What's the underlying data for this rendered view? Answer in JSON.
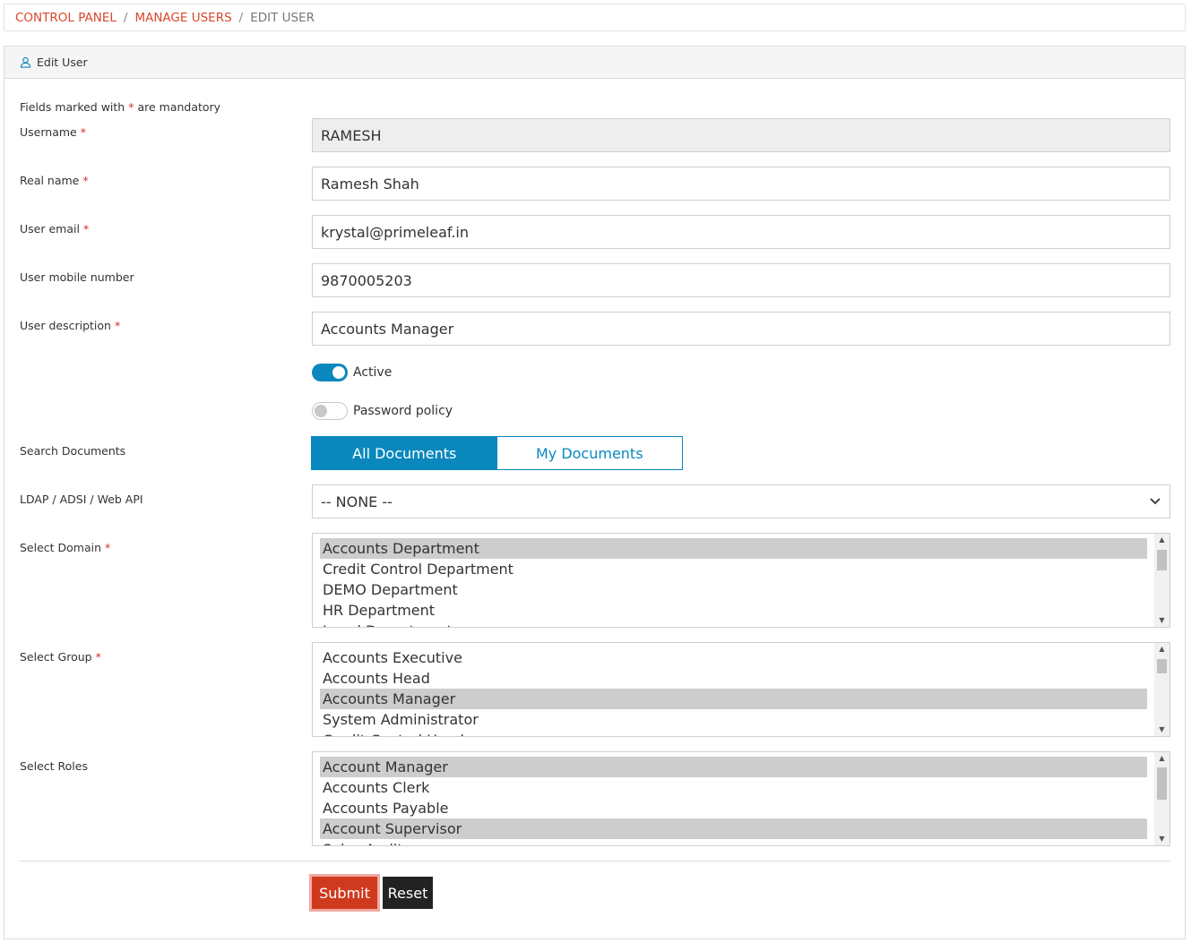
{
  "breadcrumb": {
    "items": [
      {
        "label": "CONTROL PANEL"
      },
      {
        "label": "MANAGE USERS"
      },
      {
        "label": "EDIT USER"
      }
    ],
    "separator": "/"
  },
  "panel": {
    "title": "Edit User",
    "mandatory_prefix": "Fields marked with",
    "mandatory_star": "*",
    "mandatory_suffix": "are mandatory"
  },
  "form": {
    "username": {
      "label": "Username",
      "value": "RAMESH"
    },
    "real_name": {
      "label": "Real name",
      "value": "Ramesh Shah"
    },
    "email": {
      "label": "User email",
      "value": "krystal@primeleaf.in"
    },
    "mobile": {
      "label": "User mobile number",
      "value": "9870005203"
    },
    "description": {
      "label": "User description",
      "value": "Accounts Manager"
    },
    "active": {
      "label": "Active",
      "on": true
    },
    "password_policy": {
      "label": "Password policy",
      "on": false
    },
    "search_documents": {
      "label": "Search Documents",
      "options": [
        "All Documents",
        "My Documents"
      ],
      "selected": "All Documents"
    },
    "ldap": {
      "label": "LDAP / ADSI / Web API",
      "value": "-- NONE --"
    },
    "domain": {
      "label": "Select Domain",
      "items": [
        "Accounts Department",
        "Credit Control Department",
        "DEMO Department",
        "HR Department",
        "Legal Department"
      ],
      "selected": [
        "Accounts Department"
      ]
    },
    "group": {
      "label": "Select Group",
      "items": [
        "Accounts Executive",
        "Accounts Head",
        "Accounts Manager",
        "System Administrator",
        "Credit Control Head"
      ],
      "selected": [
        "Accounts Manager"
      ]
    },
    "roles": {
      "label": "Select Roles",
      "items": [
        "Account Manager",
        "Accounts Clerk",
        "Accounts Payable",
        "Account Supervisor",
        "Sales Auditor"
      ],
      "selected": [
        "Account Manager",
        "Account Supervisor"
      ]
    },
    "required_star": "*"
  },
  "buttons": {
    "submit": "Submit",
    "reset": "Reset"
  },
  "colors": {
    "accent": "#0a88be",
    "danger": "#cf3a1f",
    "link": "#d9472b"
  }
}
